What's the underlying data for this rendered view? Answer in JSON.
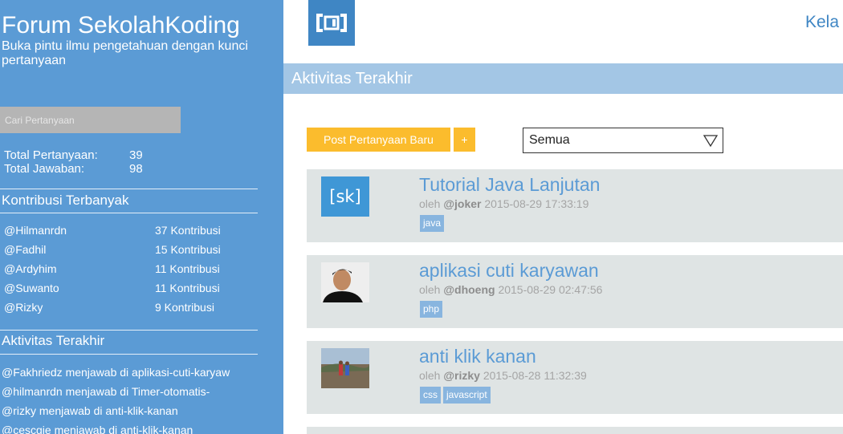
{
  "sidebar": {
    "title": "Forum SekolahKoding",
    "tagline": "Buka pintu ilmu pengetahuan dengan kunci pertanyaan",
    "search_placeholder": "Cari Pertanyaan",
    "stats": [
      {
        "label": "Total Pertanyaan:",
        "value": "39"
      },
      {
        "label": "Total Jawaban:",
        "value": "98"
      }
    ],
    "contrib_title": "Kontribusi Terbanyak",
    "contributors": [
      {
        "name": "@Hilmanrdn",
        "count": "37 Kontribusi"
      },
      {
        "name": "@Fadhil",
        "count": "15 Kontribusi"
      },
      {
        "name": "@Ardyhim",
        "count": "11 Kontribusi"
      },
      {
        "name": "@Suwanto",
        "count": "11 Kontribusi"
      },
      {
        "name": "@Rizky",
        "count": "9 Kontribusi"
      }
    ],
    "activity_title": "Aktivitas Terakhir",
    "activities": [
      "@Fakhriedz menjawab di aplikasi-cuti-karyaw",
      "@hilmanrdn menjawab di Timer-otomatis-",
      "@rizky menjawab di anti-klik-kanan",
      "@cescgie menjawab di anti-klik-kanan"
    ]
  },
  "header": {
    "logo_icon": "bracket-logo-icon",
    "nav_link": "Kela"
  },
  "main": {
    "section_title": "Aktivitas Terakhir",
    "post_button": "Post Pertanyaan Baru",
    "plus_button": "+",
    "filter_value": "Semua",
    "questions": [
      {
        "title": "Tutorial Java Lanjutan",
        "by": "oleh",
        "user": "@joker",
        "date": "2015-08-29 17:33:19",
        "tags": [
          "java"
        ],
        "thumb_text": "[sk]"
      },
      {
        "title": "aplikasi cuti karyawan",
        "by": "oleh",
        "user": "@dhoeng",
        "date": "2015-08-29 02:47:56",
        "tags": [
          "php"
        ]
      },
      {
        "title": "anti klik kanan",
        "by": "oleh",
        "user": "@rizky",
        "date": "2015-08-28 11:32:39",
        "tags": [
          "css",
          "javascript"
        ]
      }
    ]
  },
  "colors": {
    "sidebar_bg": "#5b9bd5",
    "accent": "#3f86c4",
    "section_bar": "#a3c6e5",
    "button": "#fbbc2d",
    "card_bg": "#dfe4e4",
    "tag_bg": "#88b5df"
  }
}
